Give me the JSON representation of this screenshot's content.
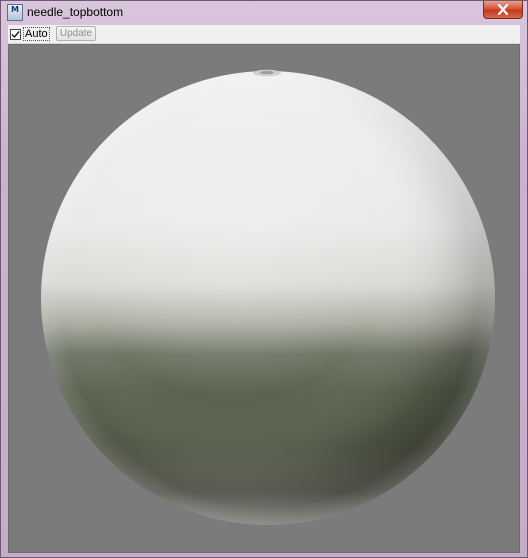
{
  "window": {
    "title": "needle_topbottom",
    "app_icon_text": "M",
    "close_icon": "close-icon"
  },
  "toolbar": {
    "auto_label": "Auto",
    "auto_checked": true,
    "update_label": "Update",
    "update_enabled": false
  },
  "viewport": {
    "background_color": "#7b7b7b",
    "sphere_top_color": "#f2f2f2",
    "sphere_bottom_color": "#4d5443"
  }
}
